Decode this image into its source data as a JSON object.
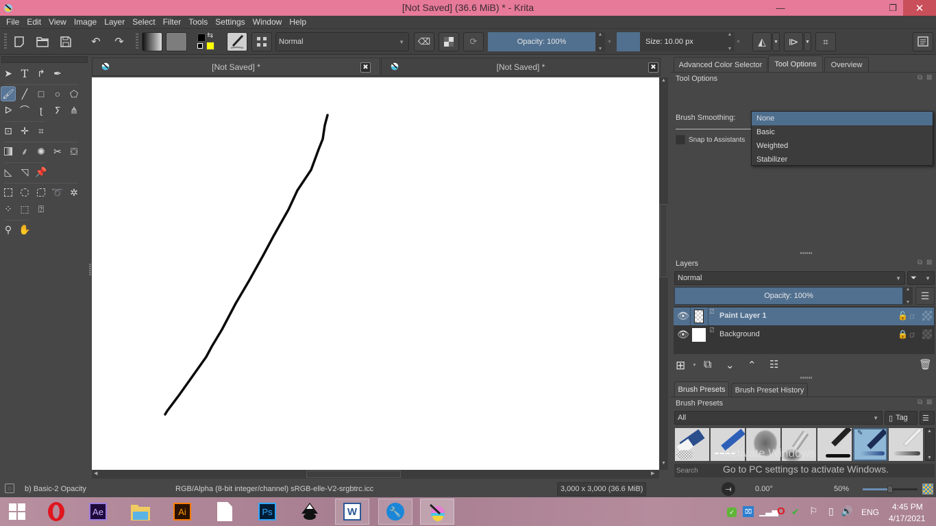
{
  "window": {
    "title": "[Not Saved]  (36.6 MiB)  * - Krita",
    "buttons": {
      "minimize": "—",
      "restore": "❐",
      "close": "✕"
    }
  },
  "menu": [
    "File",
    "Edit",
    "View",
    "Image",
    "Layer",
    "Select",
    "Filter",
    "Tools",
    "Settings",
    "Window",
    "Help"
  ],
  "toolbar": {
    "blend_mode": "Normal",
    "opacity_label": "Opacity: 100%",
    "opacity_value": 100,
    "size_label": "Size: 10.00 px",
    "size_value": 10.0,
    "foreground_color": "#000000",
    "background_color": "#ffff00"
  },
  "document_tabs": [
    {
      "label": "[Not Saved]  *"
    },
    {
      "label": "[Not Saved]  *"
    }
  ],
  "docker_tabs": [
    "Advanced Color Selector",
    "Tool Options",
    "Overview"
  ],
  "tool_options": {
    "header": "Tool Options",
    "brush_smoothing_label": "Brush Smoothing:",
    "snap_label": "Snap to Assistants",
    "snap_checked": false,
    "smoothing_options": [
      "None",
      "Basic",
      "Weighted",
      "Stabilizer"
    ],
    "smoothing_selected": "None"
  },
  "layers": {
    "header": "Layers",
    "blend_mode": "Normal",
    "opacity_label": "Opacity:  100%",
    "items": [
      {
        "name": "Paint Layer 1",
        "selected": true,
        "locked": false
      },
      {
        "name": "Background",
        "selected": false,
        "locked": true
      }
    ]
  },
  "brush_presets": {
    "tabs": [
      "Brush Presets",
      "Brush Preset History"
    ],
    "header": "Brush Presets",
    "filter": "All",
    "tag_label": "Tag",
    "search_placeholder": "Search",
    "presets": [
      "eraser",
      "blue-marker",
      "airbrush-soft",
      "ink-pen",
      "black-pencil",
      "basic-pen-selected",
      "fine-pencil"
    ]
  },
  "status": {
    "brush_name": "b) Basic-2 Opacity",
    "color_space": "RGB/Alpha (8-bit integer/channel)  sRGB-elle-V2-srgbtrc.icc",
    "image_size": "3,000 x 3,000 (36.6 MiB)",
    "rotation": "0.00°",
    "zoom": "50%",
    "zoom_fraction": 0.5
  },
  "watermark": {
    "line1": "Activate Windows",
    "line2": "Go to PC settings to activate Windows."
  },
  "taskbar": {
    "apps": [
      "Windows Start",
      "Opera",
      "After Effects",
      "File Explorer",
      "Illustrator",
      "Blank Document",
      "Photoshop",
      "Inkscape",
      "Word",
      "Settings",
      "Krita"
    ],
    "language": "ENG",
    "time": "4:45 PM",
    "date": "4/17/2021"
  }
}
